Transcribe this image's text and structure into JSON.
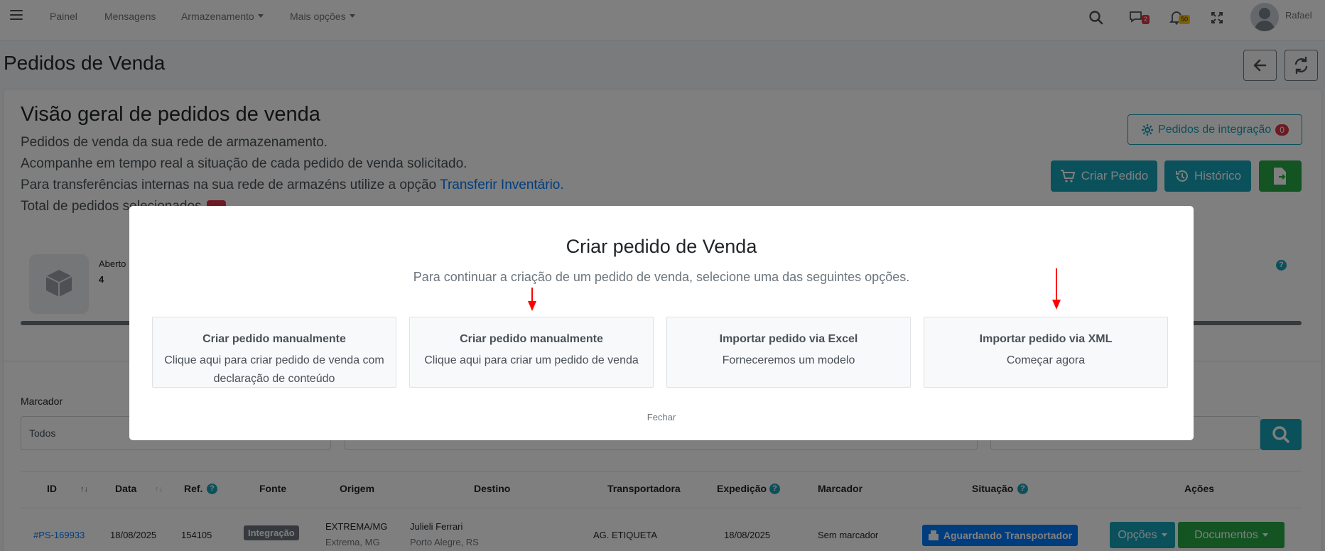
{
  "navbar": {
    "links": [
      "Painel",
      "Mensagens",
      "Armazenamento",
      "Mais opções"
    ],
    "messages_badge": "2",
    "notifications_badge": "50",
    "user_name": "Rafael"
  },
  "page": {
    "title": "Pedidos de Venda"
  },
  "overview": {
    "title": "Visão geral de pedidos de venda",
    "line1": "Pedidos de venda da sua rede de armazenamento.",
    "line2": "Acompanhe em tempo real a situação de cada pedido de venda solicitado.",
    "line3_prefix": "Para transferências internas na sua rede de armazéns utilize a opção ",
    "line3_link": "Transferir Inventário.",
    "line4": "Total de pedidos selecionados",
    "integration_button": "Pedidos de integração",
    "integration_count": "0",
    "create_button": "Criar Pedido",
    "history_button": "Histórico"
  },
  "stats": {
    "label": "Aberto",
    "value": "4"
  },
  "filters": {
    "label": "Marcador",
    "value": "Todos"
  },
  "table": {
    "headers": [
      "ID",
      "Data",
      "Ref.",
      "Fonte",
      "Origem",
      "Destino",
      "Transportadora",
      "Expedição",
      "Marcador",
      "Situação",
      "Ações"
    ],
    "row": {
      "id": "#PS-169933",
      "date": "18/08/2025",
      "ref": "154105",
      "source": "Integração",
      "origin1": "EXTREMA/MG",
      "origin2": "Extrema, MG",
      "dest1": "Julieli Ferrari",
      "dest2": "Porto Alegre, RS",
      "carrier": "AG. ETIQUETA",
      "shipping": "18/08/2025",
      "tag": "Sem marcador",
      "status": "Aguardando Transportador",
      "options": "Opções",
      "documents": "Documentos"
    }
  },
  "modal": {
    "title": "Criar pedido de Venda",
    "subtitle": "Para continuar a criação de um pedido de venda, selecione uma das seguintes opções.",
    "options": [
      {
        "title": "Criar pedido manualmente",
        "desc": "Clique aqui para criar pedido de venda com declaração de conteúdo"
      },
      {
        "title": "Criar pedido manualmente",
        "desc": "Clique aqui para criar um pedido de venda"
      },
      {
        "title": "Importar pedido via Excel",
        "desc": "Forneceremos um modelo"
      },
      {
        "title": "Importar pedido via XML",
        "desc": "Começar agora"
      }
    ],
    "close": "Fechar"
  }
}
